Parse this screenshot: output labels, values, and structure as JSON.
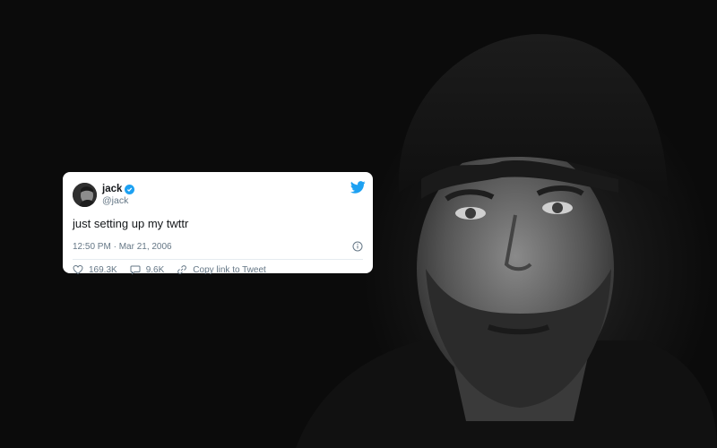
{
  "tweet": {
    "display_name": "jack",
    "handle": "@jack",
    "verified": true,
    "text": "just setting up my twttr",
    "timestamp": "12:50 PM · Mar 21, 2006",
    "likes": "169.3K",
    "replies": "9.6K",
    "copy_link_label": "Copy link to Tweet"
  },
  "icons": {
    "brand": "twitter-bird-icon",
    "verified": "verified-badge-icon",
    "info": "info-icon",
    "like": "heart-icon",
    "reply": "speech-bubble-icon",
    "link": "link-icon"
  },
  "colors": {
    "twitter_blue": "#1da1f2",
    "text_primary": "#14171a",
    "text_secondary": "#657786",
    "background": "#0b0b0b"
  }
}
